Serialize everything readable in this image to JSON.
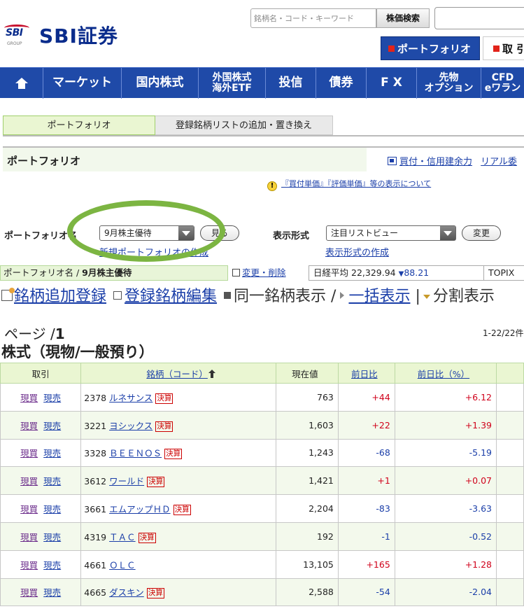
{
  "header": {
    "logo_mark": "SBI",
    "logo_group": "GROUP",
    "logo_text": "SBI証券",
    "search_placeholder": "銘柄名・コード・キーワード",
    "search_button": "株価検索",
    "portfolio_tab": "ポートフォリオ",
    "trade_tab": "取 引"
  },
  "nav": {
    "items": [
      {
        "label": "",
        "icon": "home-icon"
      },
      {
        "label": "マーケット"
      },
      {
        "label": "国内株式"
      },
      {
        "label1": "外国株式",
        "label2": "海外ETF"
      },
      {
        "label": "投信"
      },
      {
        "label": "債券"
      },
      {
        "label": "F X"
      },
      {
        "label1": "先物",
        "label2": "オプション"
      },
      {
        "label1": "CFD",
        "label2": "eワラン"
      }
    ]
  },
  "subtabs": {
    "active": "ポートフォリオ",
    "inactive": "登録銘柄リストの追加・置き換え"
  },
  "section": {
    "title": "ポートフォリオ",
    "buying_power_link": "買付・信用建余力",
    "realtime_link": "リアル委"
  },
  "notice": {
    "text": "『買付単価』『評価単価』等の表示について"
  },
  "selector": {
    "portfolio_label": "ポートフォリオ名",
    "portfolio_value": "9月株主優待",
    "view_button": "見る",
    "display_label": "表示形式",
    "display_value": "注目リストビュー",
    "change_button": "変更",
    "new_portfolio_link": "新規ポートフォリオの作成",
    "display_create_link": "表示形式の作成"
  },
  "info": {
    "portfolio_prefix": "ポートフォリオ名 /",
    "portfolio_name": "9月株主優待",
    "edit_link": "変更・削除",
    "nikkei_label": "日経平均",
    "nikkei_value": "22,329.94",
    "nikkei_change": "88.21",
    "topix_label": "TOPIX"
  },
  "actions": {
    "add": "銘柄追加登録",
    "edit": "登録銘柄編集",
    "same": "同一銘柄表示 /",
    "bulk": "一括表示",
    "sep": "|",
    "split": "分割表示"
  },
  "paging": {
    "page_prefix": "ページ /",
    "page_num": "1",
    "count": "1-22/22件"
  },
  "stock_heading": "株式（現物/一般預り）",
  "table": {
    "headers": {
      "trade": "取引",
      "name": "銘柄（コード）",
      "price": "現在値",
      "change": "前日比",
      "pct": "前日比（%）"
    },
    "buy_label": "現買",
    "sell_label": "現売",
    "kessan_label": "決算",
    "rows": [
      {
        "code": "2378",
        "name": "ルネサンス",
        "kessan": true,
        "price": "763",
        "change": "+44",
        "pct": "+6.12",
        "dir": "pos"
      },
      {
        "code": "3221",
        "name": "ヨシックス",
        "kessan": true,
        "price": "1,603",
        "change": "+22",
        "pct": "+1.39",
        "dir": "pos"
      },
      {
        "code": "3328",
        "name": "ＢＥＥＮＯＳ",
        "kessan": true,
        "price": "1,243",
        "change": "-68",
        "pct": "-5.19",
        "dir": "neg"
      },
      {
        "code": "3612",
        "name": "ワールド",
        "kessan": true,
        "price": "1,421",
        "change": "+1",
        "pct": "+0.07",
        "dir": "pos"
      },
      {
        "code": "3661",
        "name": "エムアップＨＤ",
        "kessan": true,
        "price": "2,204",
        "change": "-83",
        "pct": "-3.63",
        "dir": "neg"
      },
      {
        "code": "4319",
        "name": "ＴＡＣ",
        "kessan": true,
        "price": "192",
        "change": "-1",
        "pct": "-0.52",
        "dir": "neg"
      },
      {
        "code": "4661",
        "name": "ＯＬＣ",
        "kessan": false,
        "price": "13,105",
        "change": "+165",
        "pct": "+1.28",
        "dir": "pos"
      },
      {
        "code": "4665",
        "name": "ダスキン",
        "kessan": true,
        "price": "2,588",
        "change": "-54",
        "pct": "-2.04",
        "dir": "neg"
      }
    ]
  },
  "colors": {
    "brand_blue": "#1f4aa8",
    "accent_red": "#e2231a",
    "positive": "#d0021b",
    "negative": "#1a3ea8",
    "highlight_ring": "#7cb542"
  }
}
